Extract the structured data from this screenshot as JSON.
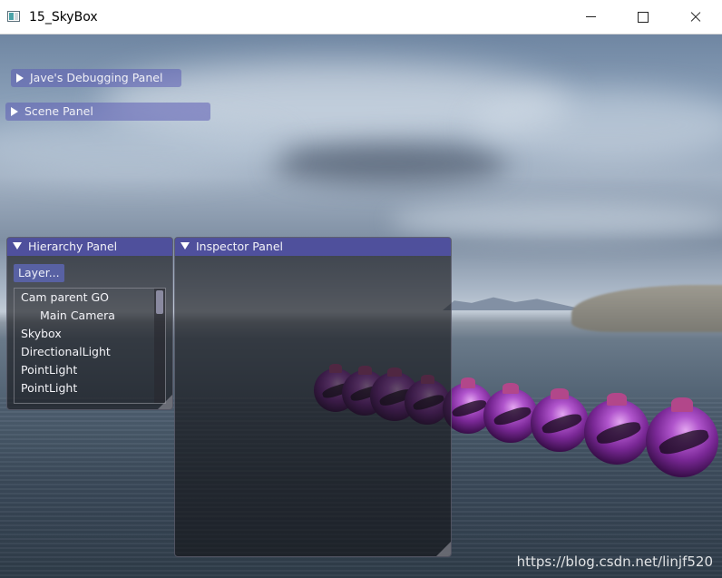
{
  "window": {
    "title": "15_SkyBox"
  },
  "panels": {
    "debug": {
      "title": "Jave's Debugging Panel"
    },
    "scene": {
      "title": "Scene Panel"
    },
    "hierarchy": {
      "title": "Hierarchy Panel",
      "layer_button": "Layer...",
      "items": [
        {
          "label": "Cam parent GO",
          "depth": 0
        },
        {
          "label": "Main Camera",
          "depth": 1
        },
        {
          "label": "Skybox",
          "depth": 0
        },
        {
          "label": "DirectionalLight",
          "depth": 0
        },
        {
          "label": "PointLight",
          "depth": 0
        },
        {
          "label": "PointLight",
          "depth": 0
        }
      ]
    },
    "inspector": {
      "title": "Inspector Panel"
    }
  },
  "watermark": "https://blog.csdn.net/linjf520",
  "colors": {
    "panel_header": "#5252aa",
    "panel_bg": "#141416",
    "sphere": "#9a3ab8"
  }
}
